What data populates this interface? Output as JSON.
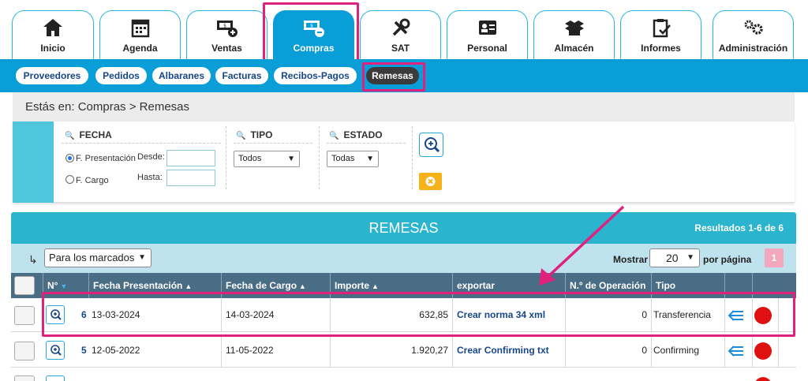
{
  "modules": [
    {
      "label": "Inicio",
      "icon": "home-icon"
    },
    {
      "label": "Agenda",
      "icon": "calendar-icon"
    },
    {
      "label": "Ventas",
      "icon": "money-plus-icon"
    },
    {
      "label": "Compras",
      "icon": "money-minus-icon"
    },
    {
      "label": "SAT",
      "icon": "tools-icon"
    },
    {
      "label": "Personal",
      "icon": "id-card-icon"
    },
    {
      "label": "Almacén",
      "icon": "boxes-icon"
    },
    {
      "label": "Informes",
      "icon": "clipboard-check-icon"
    },
    {
      "label": "Administración",
      "icon": "gears-icon"
    }
  ],
  "subnav": [
    "Proveedores",
    "Pedidos",
    "Albaranes",
    "Facturas",
    "Recibos-Pagos",
    "Remesas"
  ],
  "breadcrumb": "Estás en: Compras > Remesas",
  "filters": {
    "fecha_title": "FECHA",
    "radio_presentacion": "F. Presentación",
    "radio_cargo": "F. Cargo",
    "desde": "Desde:",
    "hasta": "Hasta:",
    "tipo_title": "TIPO",
    "tipo_value": "Todos",
    "estado_title": "ESTADO",
    "estado_value": "Todas"
  },
  "results": {
    "title": "REMESAS",
    "count": "Resultados 1-6 de 6",
    "bulk_action": "Para los marcados",
    "show_label": "Mostrar",
    "per_page": "20",
    "per_page_label": "por página",
    "page": "1"
  },
  "columns": [
    "N°",
    "Fecha Presentación",
    "Fecha de Cargo",
    "Importe",
    "exportar",
    "N.º de Operación",
    "Tipo"
  ],
  "rows": [
    {
      "num": "6",
      "presentacion": "13-03-2024",
      "cargo": "14-03-2024",
      "importe": "632,85",
      "exportar": "Crear norma 34 xml",
      "operacion": "0",
      "tipo": "Transferencia"
    },
    {
      "num": "5",
      "presentacion": "12-05-2022",
      "cargo": "11-05-2022",
      "importe": "1.920,27",
      "exportar": "Crear Confirming txt",
      "operacion": "0",
      "tipo": "Confirming"
    }
  ],
  "colors": {
    "primary": "#0a9ed8",
    "highlight": "#e0227e",
    "header": "#2bb4cd",
    "table_head": "#4a6d86",
    "status_red": "#e01010",
    "clear_button": "#f7b21a"
  }
}
